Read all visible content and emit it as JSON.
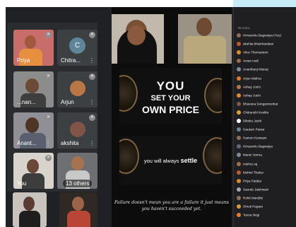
{
  "gallery": {
    "tiles": [
      {
        "name": "Priya"
      },
      {
        "name": "Chitra...",
        "initial": "C"
      },
      {
        "name": "...nan..."
      },
      {
        "name": "Arjun"
      },
      {
        "name": "Anant..."
      },
      {
        "name": "akshita"
      },
      {
        "name": "You"
      },
      {
        "name": "13 others"
      }
    ]
  },
  "slide": {
    "line1": "YOU",
    "line2": "SET YOUR",
    "line3": "OWN PRICE",
    "bottom_prefix": "you will always ",
    "bottom_word": "settle",
    "quote": "Failure doesn't mean you are a failure it just means you haven't succeeded yet."
  },
  "participants": {
    "header": "IN CALL",
    "names": [
      "Himanshu Bagwaiya (You)",
      "akshita bhalchandani",
      "Alice Thomastom",
      "Aman mali",
      "Ananthanji Manoj",
      "Arjun Mishra",
      "Ashay Joshi",
      "Ashay Joshi",
      "Bhavana Sengamnerkar",
      "Chitranshi Kushla",
      "Dikshu Joshi",
      "Gautam Pawar",
      "Hariom Keswani",
      "Himanshu Bagwaiya",
      "Mansi Verma",
      "mishra raj",
      "Mohini Thakur",
      "Priya Patidar",
      "Saurab Jaishwani",
      "Rohit Mandloi",
      "Shruti Pagare",
      "Teena Negi"
    ]
  }
}
